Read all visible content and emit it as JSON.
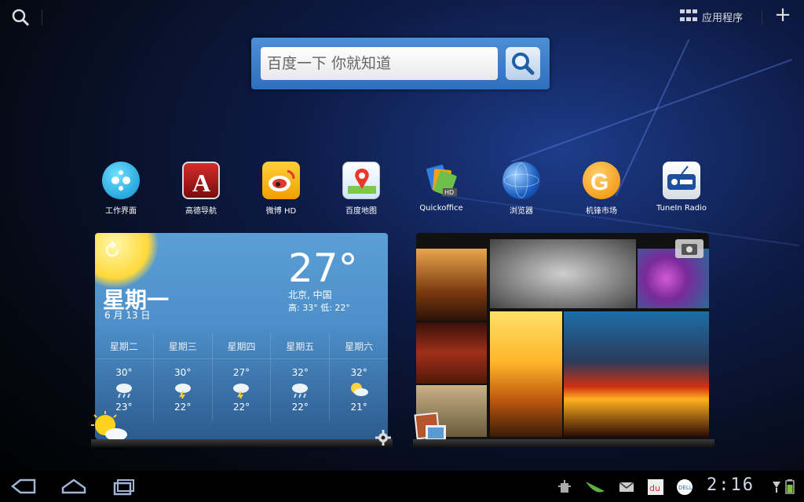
{
  "top_bar": {
    "apps_label": "应用程序"
  },
  "search": {
    "placeholder": "百度一下 你就知道"
  },
  "apps": [
    {
      "label": "工作界面"
    },
    {
      "label": "高德导航"
    },
    {
      "label": "微博 HD"
    },
    {
      "label": "百度地图"
    },
    {
      "label": "Quickoffice"
    },
    {
      "label": "浏览器"
    },
    {
      "label": "机锋市场"
    },
    {
      "label": "TuneIn Radio"
    }
  ],
  "weather": {
    "day": "星期一",
    "date": "6 月 13 日",
    "temp": "27°",
    "location": "北京, 中国",
    "hilo": "高: 33°  低: 22°",
    "forecast": [
      {
        "day": "星期二",
        "high": "30°",
        "low": "23°",
        "icon": "cloud-rain-icon"
      },
      {
        "day": "星期三",
        "high": "30°",
        "low": "22°",
        "icon": "thunderstorm-icon"
      },
      {
        "day": "星期四",
        "high": "27°",
        "low": "22°",
        "icon": "thunderstorm-icon"
      },
      {
        "day": "星期五",
        "high": "32°",
        "low": "22°",
        "icon": "cloud-rain-icon"
      },
      {
        "day": "星期六",
        "high": "32°",
        "low": "21°",
        "icon": "partly-cloudy-icon"
      }
    ]
  },
  "status": {
    "clock": "2:16"
  },
  "colors": {
    "baidu_blue": "#3a7fcc",
    "weather_bg": "#4d8fc9"
  }
}
